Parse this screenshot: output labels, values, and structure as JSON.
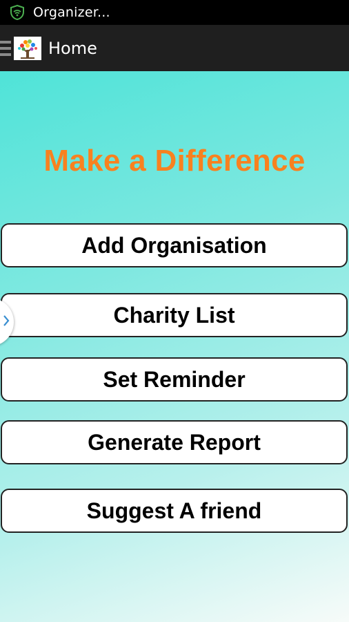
{
  "status_bar": {
    "title": "Organizer...",
    "icon": "shield-wifi-icon",
    "icon_color": "#4caf50"
  },
  "action_bar": {
    "menu_icon": "hamburger-icon",
    "app_icon": "tree-logo-icon",
    "title": "Home"
  },
  "main": {
    "headline": "Make a Difference",
    "headline_color": "#f8811f",
    "buttons": [
      {
        "label": "Add Organisation"
      },
      {
        "label": "Charity List"
      },
      {
        "label": "Set Reminder"
      },
      {
        "label": "Generate Report"
      },
      {
        "label": "Suggest A friend"
      }
    ],
    "drawer_handle_icon": "chevron-right-icon"
  }
}
